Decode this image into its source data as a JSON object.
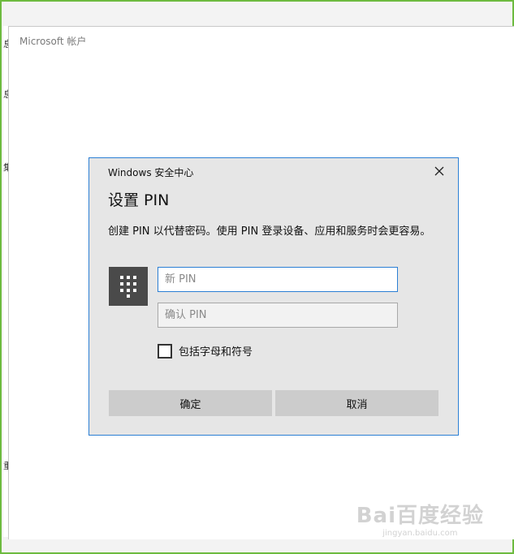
{
  "background_window": {
    "title": "Microsoft 帐户",
    "edge_chars": [
      "息",
      "息",
      "集",
      "重"
    ]
  },
  "dialog": {
    "caption": "Windows 安全中心",
    "heading": "设置 PIN",
    "description": "创建 PIN 以代替密码。使用 PIN 登录设备、应用和服务时会更容易。",
    "new_pin_placeholder": "新 PIN",
    "new_pin_value": "",
    "confirm_pin_placeholder": "确认 PIN",
    "confirm_pin_value": "",
    "checkbox_label": "包括字母和符号",
    "checkbox_checked": false,
    "ok_label": "确定",
    "cancel_label": "取消",
    "close_icon": "close-icon",
    "keypad_icon": "keypad-icon"
  },
  "watermark": {
    "logo": "Bai百度经验",
    "url": "jingyan.baidu.com"
  },
  "colors": {
    "frame_border": "#6dbb3f",
    "dialog_border": "#2b7fd4",
    "dialog_bg": "#e6e6e6",
    "button_bg": "#cccccc",
    "keypad_tile": "#4a4a4a"
  }
}
